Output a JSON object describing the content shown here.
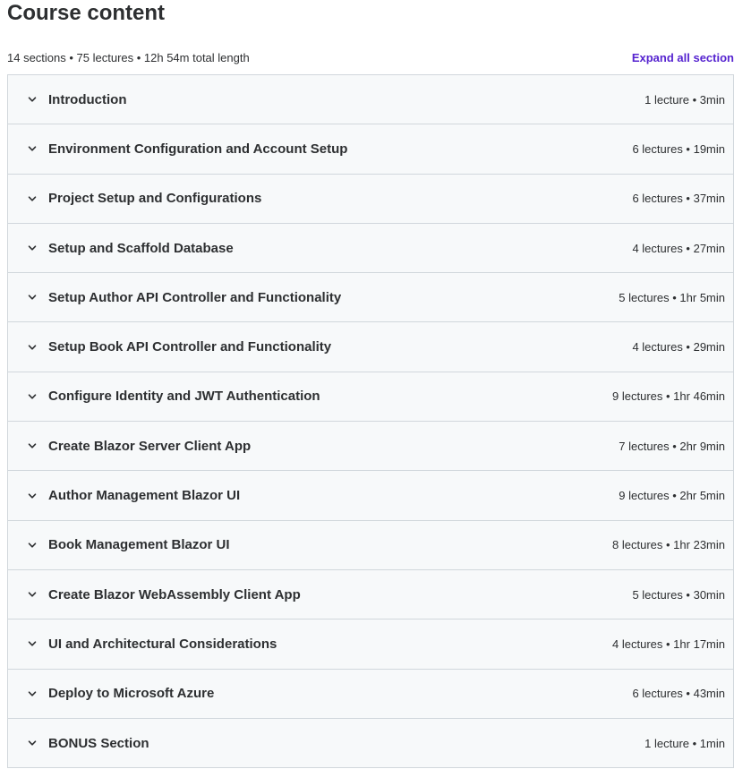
{
  "page": {
    "title": "Course content",
    "summary": "14 sections • 75 lectures • 12h 54m total length",
    "expand_all_label": "Expand all section"
  },
  "colors": {
    "accent": "#5624d0",
    "row_background": "#f7f9fa",
    "border": "#d1d7dc",
    "text": "#2d2f31"
  },
  "icons": {
    "row_toggle": "chevron-down-icon"
  },
  "sections": [
    {
      "title": "Introduction",
      "meta": "1 lecture • 3min"
    },
    {
      "title": "Environment Configuration and Account Setup",
      "meta": "6 lectures • 19min"
    },
    {
      "title": "Project Setup and Configurations",
      "meta": "6 lectures • 37min"
    },
    {
      "title": "Setup and Scaffold Database",
      "meta": "4 lectures • 27min"
    },
    {
      "title": "Setup Author API Controller and Functionality",
      "meta": "5 lectures • 1hr 5min"
    },
    {
      "title": "Setup Book API Controller and Functionality",
      "meta": "4 lectures • 29min"
    },
    {
      "title": "Configure Identity and JWT Authentication",
      "meta": "9 lectures • 1hr 46min"
    },
    {
      "title": "Create Blazor Server Client App",
      "meta": "7 lectures • 2hr 9min"
    },
    {
      "title": "Author Management Blazor UI",
      "meta": "9 lectures • 2hr 5min"
    },
    {
      "title": "Book Management Blazor UI",
      "meta": "8 lectures • 1hr 23min"
    },
    {
      "title": "Create Blazor WebAssembly Client App",
      "meta": "5 lectures • 30min"
    },
    {
      "title": "UI and Architectural Considerations",
      "meta": "4 lectures • 1hr 17min"
    },
    {
      "title": "Deploy to Microsoft Azure",
      "meta": "6 lectures • 43min"
    },
    {
      "title": "BONUS Section",
      "meta": "1 lecture • 1min"
    }
  ]
}
